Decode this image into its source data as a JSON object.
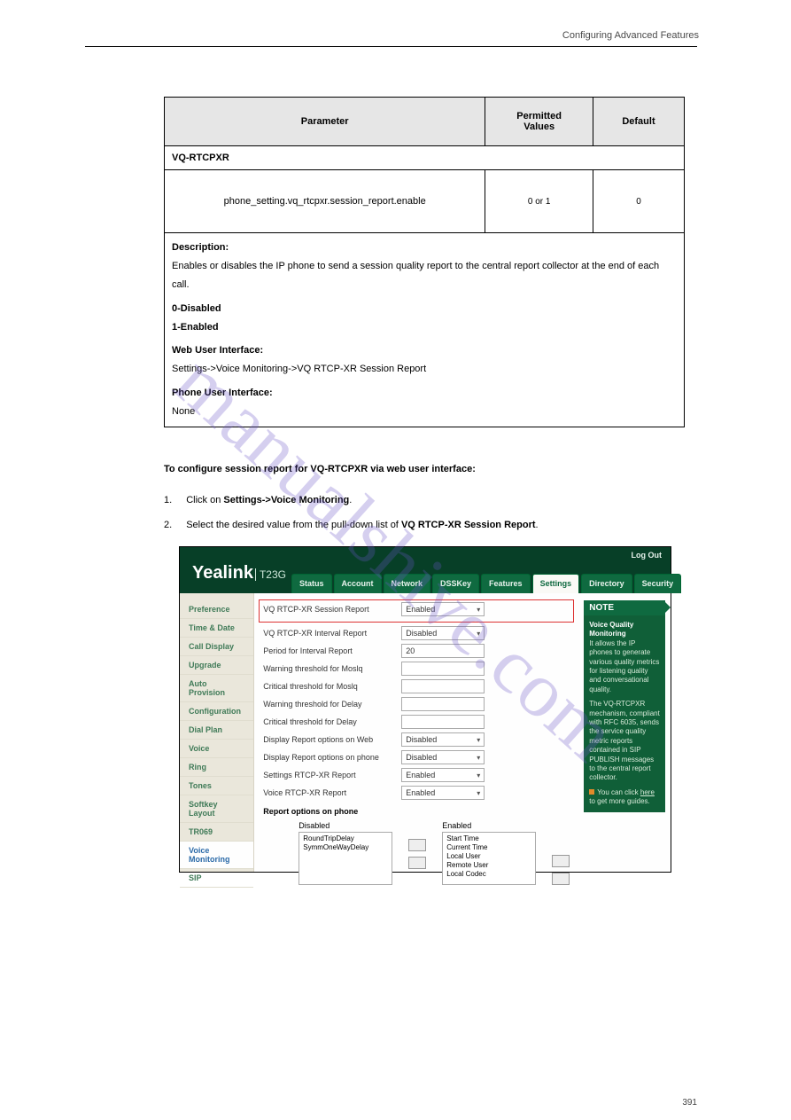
{
  "header": {
    "running": "Configuring Advanced Features"
  },
  "page_number": "391",
  "watermark": "manualshive.com",
  "table": {
    "headers": {
      "c1": "Parameter",
      "c2": "Permitted\nValues",
      "c3": "Default"
    },
    "section": "VQ-RTCPXR",
    "row": {
      "param": "phone_setting.vq_rtcpxr.session_report.enable",
      "values": "0 or 1",
      "default": "0"
    },
    "desc_label": "Description:",
    "desc_body1": "Enables or disables the IP phone to send a session quality report to the central report collector at the end of each call.",
    "desc_0": "0-Disabled",
    "desc_1": "1-Enabled",
    "wui_label": "Web User Interface:",
    "wui_path": "Settings->Voice Monitoring->VQ RTCP-XR Session Report",
    "pui_label": "Phone User Interface:",
    "pui_val": "None"
  },
  "body": {
    "lead": "To configure session report for VQ-RTCPXR via web user interface:",
    "step1_num": "1.",
    "step1_txt_a": "Click on ",
    "step1_nav": "Settings->Voice Monitoring",
    "step1_txt_b": ".",
    "step2_num": "2.",
    "step2_txt_a": "Select the desired value from the pull-down list of ",
    "step2_field": "VQ RTCP-XR Session Report",
    "step2_txt_b": "."
  },
  "screenshot": {
    "brand": "Yealink",
    "model": "T23G",
    "logout": "Log Out",
    "tabs": [
      "Status",
      "Account",
      "Network",
      "DSSKey",
      "Features",
      "Settings",
      "Directory",
      "Security"
    ],
    "tabs_active": "Settings",
    "left_items": [
      "Preference",
      "Time & Date",
      "Call Display",
      "Upgrade",
      "Auto Provision",
      "Configuration",
      "Dial Plan",
      "Voice",
      "Ring",
      "Tones",
      "Softkey Layout",
      "TR069",
      "Voice Monitoring",
      "SIP"
    ],
    "left_selected": "Voice Monitoring",
    "form": [
      {
        "label": "VQ RTCP-XR Session Report",
        "value": "Enabled",
        "type": "sel",
        "highlight": true
      },
      {
        "label": "VQ RTCP-XR Interval Report",
        "value": "Disabled",
        "type": "sel"
      },
      {
        "label": "Period for Interval Report",
        "value": "20",
        "type": "txt"
      },
      {
        "label": "Warning threshold for Moslq",
        "value": "",
        "type": "txt"
      },
      {
        "label": "Critical threshold for Moslq",
        "value": "",
        "type": "txt"
      },
      {
        "label": "Warning threshold for Delay",
        "value": "",
        "type": "txt"
      },
      {
        "label": "Critical threshold for Delay",
        "value": "",
        "type": "txt"
      },
      {
        "label": "Display Report options on Web",
        "value": "Disabled",
        "type": "sel"
      },
      {
        "label": "Display Report options on phone",
        "value": "Disabled",
        "type": "sel"
      },
      {
        "label": "Settings RTCP-XR Report",
        "value": "Enabled",
        "type": "sel"
      },
      {
        "label": "Voice RTCP-XR Report",
        "value": "Enabled",
        "type": "sel"
      }
    ],
    "section_title": "Report options on phone",
    "transfer": {
      "disabled_hdr": "Disabled",
      "disabled_items": [
        "RoundTripDelay",
        "SymmOneWayDelay"
      ],
      "enabled_hdr": "Enabled",
      "enabled_items": [
        "Start Time",
        "Current Time",
        "Local User",
        "Remote User",
        "Local Codec"
      ]
    },
    "note": {
      "title": "NOTE",
      "h1": "Voice Quality Monitoring",
      "p1": "It allows the IP phones to generate various quality metrics for listening quality and conversational quality.",
      "p2": "The VQ-RTCPXR mechanism, compliant with RFC 6035, sends the service quality metric reports contained in SIP PUBLISH messages to the central report collector.",
      "p3a": "You can click ",
      "p3link": "here",
      "p3b": " to get more guides."
    }
  }
}
